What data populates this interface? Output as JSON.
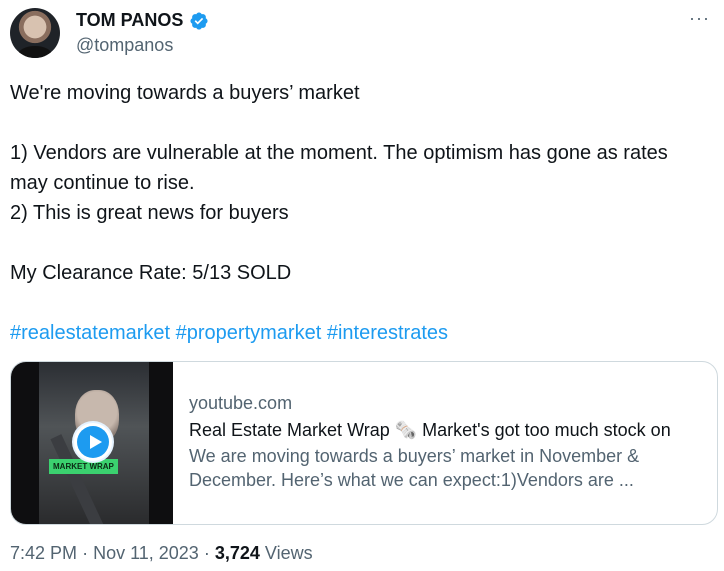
{
  "author": {
    "name": "TOM PANOS",
    "handle": "@tompanos",
    "verified": true,
    "verified_color": "#1d9bf0"
  },
  "more_menu": "···",
  "tweet": {
    "line1": "We're moving towards a buyers’ market",
    "line2": "1) Vendors are vulnerable at the moment. The optimism has gone as rates may continue to rise.",
    "line3": "2) This is great news for buyers",
    "line4": "My Clearance Rate: 5/13 SOLD",
    "hashtags": [
      "#realestatemarket",
      "#propertymarket",
      "#interestrates"
    ],
    "hashtag_color": "#1d9bf0"
  },
  "card": {
    "domain": "youtube.com",
    "title": "Real Estate Market Wrap 🗞️ Market's got too much stock on",
    "description": "We are moving towards a buyers’ market in November & December. Here’s what we can expect:1)Vendors are ...",
    "thumbnail_tag": "MARKET WRAP",
    "play_icon": "play-icon"
  },
  "meta": {
    "time": "7:42 PM",
    "separator": "·",
    "date": "Nov 11, 2023",
    "views_count": "3,724",
    "views_label": "Views"
  }
}
